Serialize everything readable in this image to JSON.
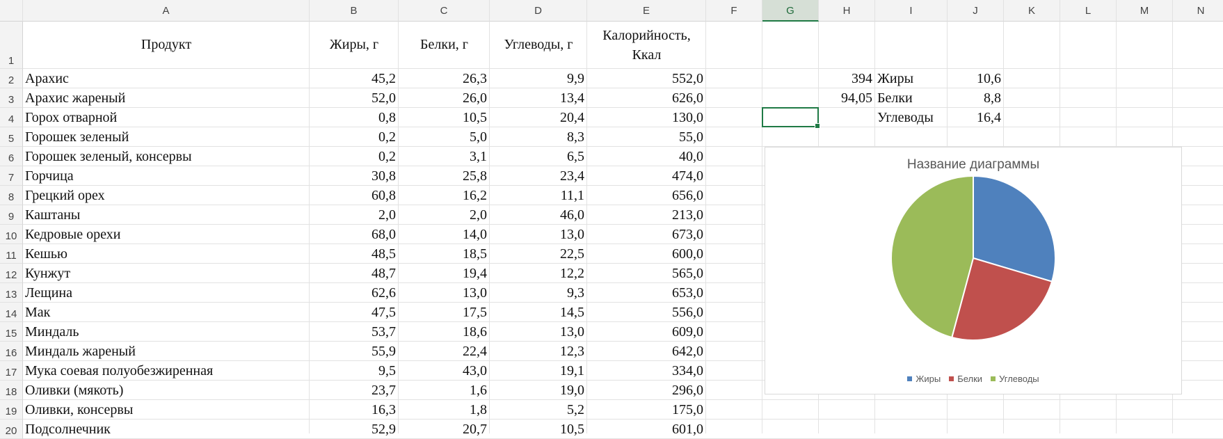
{
  "columns": [
    "A",
    "B",
    "C",
    "D",
    "E",
    "F",
    "G",
    "H",
    "I",
    "J",
    "K",
    "L",
    "M",
    "N"
  ],
  "active_column": "G",
  "row_numbers": [
    "1",
    "2",
    "3",
    "4",
    "5",
    "6",
    "7",
    "8",
    "9",
    "10",
    "11",
    "12",
    "13",
    "14",
    "15",
    "16",
    "17",
    "18",
    "19",
    "20"
  ],
  "headers": {
    "product": "Продукт",
    "fat": "Жиры, г",
    "protein": "Белки, г",
    "carbs": "Углеводы, г",
    "calories_line1": "Калорийность,",
    "calories_line2": "Ккал"
  },
  "rows": [
    {
      "product": "Арахис",
      "fat": "45,2",
      "protein": "26,3",
      "carbs": "9,9",
      "kcal": "552,0"
    },
    {
      "product": "Арахис жареный",
      "fat": "52,0",
      "protein": "26,0",
      "carbs": "13,4",
      "kcal": "626,0"
    },
    {
      "product": "Горох отварной",
      "fat": "0,8",
      "protein": "10,5",
      "carbs": "20,4",
      "kcal": "130,0"
    },
    {
      "product": "Горошек зеленый",
      "fat": "0,2",
      "protein": "5,0",
      "carbs": "8,3",
      "kcal": "55,0"
    },
    {
      "product": "Горошек зеленый, консервы",
      "fat": "0,2",
      "protein": "3,1",
      "carbs": "6,5",
      "kcal": "40,0"
    },
    {
      "product": "Горчица",
      "fat": "30,8",
      "protein": "25,8",
      "carbs": "23,4",
      "kcal": "474,0"
    },
    {
      "product": "Грецкий орех",
      "fat": "60,8",
      "protein": "16,2",
      "carbs": "11,1",
      "kcal": "656,0"
    },
    {
      "product": "Каштаны",
      "fat": "2,0",
      "protein": "2,0",
      "carbs": "46,0",
      "kcal": "213,0"
    },
    {
      "product": "Кедровые орехи",
      "fat": "68,0",
      "protein": "14,0",
      "carbs": "13,0",
      "kcal": "673,0"
    },
    {
      "product": "Кешью",
      "fat": "48,5",
      "protein": "18,5",
      "carbs": "22,5",
      "kcal": "600,0"
    },
    {
      "product": "Кунжут",
      "fat": "48,7",
      "protein": "19,4",
      "carbs": "12,2",
      "kcal": "565,0"
    },
    {
      "product": "Лещина",
      "fat": "62,6",
      "protein": "13,0",
      "carbs": "9,3",
      "kcal": "653,0"
    },
    {
      "product": "Мак",
      "fat": "47,5",
      "protein": "17,5",
      "carbs": "14,5",
      "kcal": "556,0"
    },
    {
      "product": "Миндаль",
      "fat": "53,7",
      "protein": "18,6",
      "carbs": "13,0",
      "kcal": "609,0"
    },
    {
      "product": "Миндаль жареный",
      "fat": "55,9",
      "protein": "22,4",
      "carbs": "12,3",
      "kcal": "642,0"
    },
    {
      "product": "Мука соевая полуобезжиренная",
      "fat": "9,5",
      "protein": "43,0",
      "carbs": "19,1",
      "kcal": "334,0"
    },
    {
      "product": "Оливки (мякоть)",
      "fat": "23,7",
      "protein": "1,6",
      "carbs": "19,0",
      "kcal": "296,0"
    },
    {
      "product": "Оливки, консервы",
      "fat": "16,3",
      "protein": "1,8",
      "carbs": "5,2",
      "kcal": "175,0"
    },
    {
      "product": "Подсолнечник",
      "fat": "52,9",
      "protein": "20,7",
      "carbs": "10,5",
      "kcal": "601,0"
    }
  ],
  "side_values": {
    "h2": "394",
    "h3": "94,05",
    "i2": "Жиры",
    "i3": "Белки",
    "i4": "Углеводы",
    "j2": "10,6",
    "j3": "8,8",
    "j4": "16,4"
  },
  "chart_data": {
    "type": "pie",
    "title": "Название диаграммы",
    "categories": [
      "Жиры",
      "Белки",
      "Углеводы"
    ],
    "values": [
      10.6,
      8.8,
      16.4
    ],
    "colors": [
      "#4f81bd",
      "#c0504d",
      "#9bbb59"
    ],
    "legend_position": "bottom"
  }
}
